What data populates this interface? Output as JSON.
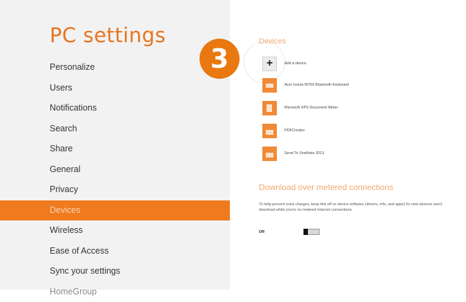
{
  "app": {
    "title": "PC settings"
  },
  "nav": {
    "items": [
      {
        "label": "Personalize"
      },
      {
        "label": "Users"
      },
      {
        "label": "Notifications"
      },
      {
        "label": "Search"
      },
      {
        "label": "Share"
      },
      {
        "label": "General"
      },
      {
        "label": "Privacy"
      },
      {
        "label": "Devices",
        "selected": true
      },
      {
        "label": "Wireless"
      },
      {
        "label": "Ease of Access"
      },
      {
        "label": "Sync your settings"
      },
      {
        "label": "HomeGroup"
      }
    ]
  },
  "devices": {
    "title": "Devices",
    "items": [
      {
        "label": "Add a device",
        "icon": "plus-icon"
      },
      {
        "label": "Acer Iconia W700 Bluetooth Keyboard",
        "icon": "keyboard-icon"
      },
      {
        "label": "Microsoft XPS Document Writer",
        "icon": "printer-icon"
      },
      {
        "label": "PDFCreator",
        "icon": "printer-icon"
      },
      {
        "label": "Send To OneNote 2013",
        "icon": "printer-icon"
      }
    ]
  },
  "metered": {
    "title": "Download over metered connections",
    "description": "To help prevent extra charges, keep this off so device software (drivers, info, and apps) for new devices won't download while you're on metered Internet connections.",
    "toggle_label": "Off"
  },
  "annotation": {
    "step": "3"
  },
  "colors": {
    "accent": "#f07a1e",
    "badge": "#e8780f",
    "sidebar_bg": "#f2f2f2"
  }
}
